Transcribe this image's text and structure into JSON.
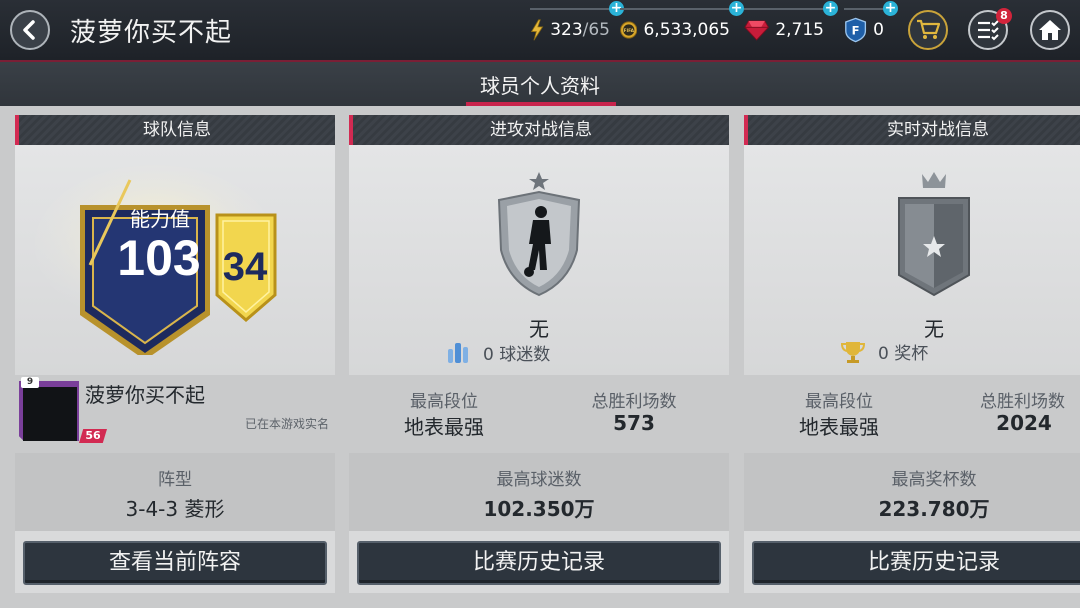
{
  "header": {
    "title": "菠萝你买不起",
    "energy": "323",
    "energy_max": "/65",
    "coins": "6,533,065",
    "gems": "2,715",
    "fpoints": "0",
    "notify_count": "8",
    "coin_logo_text": "FIFA"
  },
  "tab": {
    "label": "球员个人资料"
  },
  "team_panel": {
    "header": "球队信息",
    "power_label": "能力值",
    "power_value": "103",
    "level_value": "34",
    "player_name": "菠萝你买不起",
    "avatar_level": "56",
    "avatar_tag": "9",
    "verified_text": "已在本游戏实名",
    "formation_label": "阵型",
    "formation_value": "3-4-3 菱形",
    "button": "查看当前阵容"
  },
  "attack_panel": {
    "header": "进攻对战信息",
    "rank_name": "无",
    "fans_count": "0 球迷数",
    "best_rank_label": "最高段位",
    "best_rank_value": "地表最强",
    "total_wins_label": "总胜利场数",
    "total_wins_value": "573",
    "max_fans_label": "最高球迷数",
    "max_fans_value": "102.350万",
    "button": "比赛历史记录"
  },
  "live_panel": {
    "header": "实时对战信息",
    "rank_name": "无",
    "trophy_count": "0 奖杯",
    "best_rank_label": "最高段位",
    "best_rank_value": "地表最强",
    "total_wins_label": "总胜利场数",
    "total_wins_value": "2024",
    "max_trophy_label": "最高奖杯数",
    "max_trophy_value": "223.780万",
    "button": "比赛历史记录"
  },
  "colors": {
    "accent": "#d22a52",
    "topbar": "#1e2228",
    "gold": "#c9a33a",
    "plus": "#2bb3d8"
  }
}
